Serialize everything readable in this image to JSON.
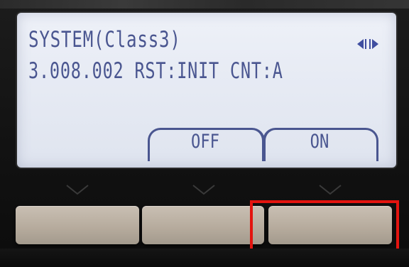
{
  "screen": {
    "line1": "SYSTEM(Class3)",
    "line2": "3.008.002 RST:INIT CNT:A",
    "nav_icon": "left-right-arrows-icon"
  },
  "softkeys": [
    {
      "label": "OFF"
    },
    {
      "label": "ON"
    }
  ],
  "colors": {
    "lcd_background": "#e7ebf4",
    "lcd_text": "#4a5690",
    "button_face": "#b5aa9c",
    "highlight": "#e3140f"
  }
}
